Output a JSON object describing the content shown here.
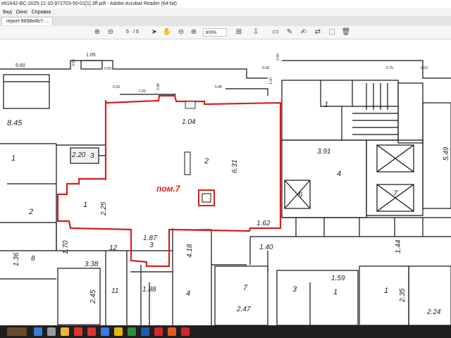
{
  "window": {
    "title": "e61642-BC-2025-11-10-972703-50-01[1].3ff.pdf - Adobe Acrobat Reader (64-bit)"
  },
  "menu": [
    "Вид",
    "Окно",
    "Справка"
  ],
  "tab": {
    "label": "report-9658e4b7-..."
  },
  "toolbar": {
    "page_current": "5",
    "page_total": "/ 5",
    "zoom": "800%"
  },
  "plan": {
    "room_label": "пом.7",
    "dims": [
      "5.60",
      "1.05",
      "0.55",
      "0.60",
      "0.33",
      "1.99",
      "0.98",
      "5.48",
      "1.00",
      "0.28",
      "2.40",
      "0.75",
      "0.53",
      "8.45",
      "2.20",
      "1.04",
      "6.31",
      "3.91",
      "5.49",
      "2.25",
      "1.87",
      "1.62",
      "1.40",
      "1.70",
      "3.38",
      "1.36",
      "4.18",
      "1.44",
      "1.59",
      "2.45",
      "1.88",
      "2.47",
      "2.35",
      "2.24"
    ],
    "rooms": [
      "1",
      "3",
      "2",
      "1",
      "2",
      "4",
      "6",
      "7",
      "12",
      "3",
      "8",
      "11",
      "4",
      "7",
      "3",
      "1",
      "1",
      "1"
    ]
  },
  "taskbar": {
    "icons": [
      "search-icon",
      "task-view-icon",
      "files-icon",
      "yandex-icon",
      "chrome-icon",
      "mail-icon",
      "app-icon",
      "maps-icon",
      "word-icon",
      "opera-icon",
      "office-icon",
      "acrobat-icon"
    ],
    "colors": [
      "#3b7bd8",
      "#9a9a9a",
      "#f2b531",
      "#e0322b",
      "#e0322b",
      "#3a7be0",
      "#e6b800",
      "#2e8d3f",
      "#1f5bb5",
      "#d6262d",
      "#e05a1a",
      "#d4232b"
    ]
  }
}
